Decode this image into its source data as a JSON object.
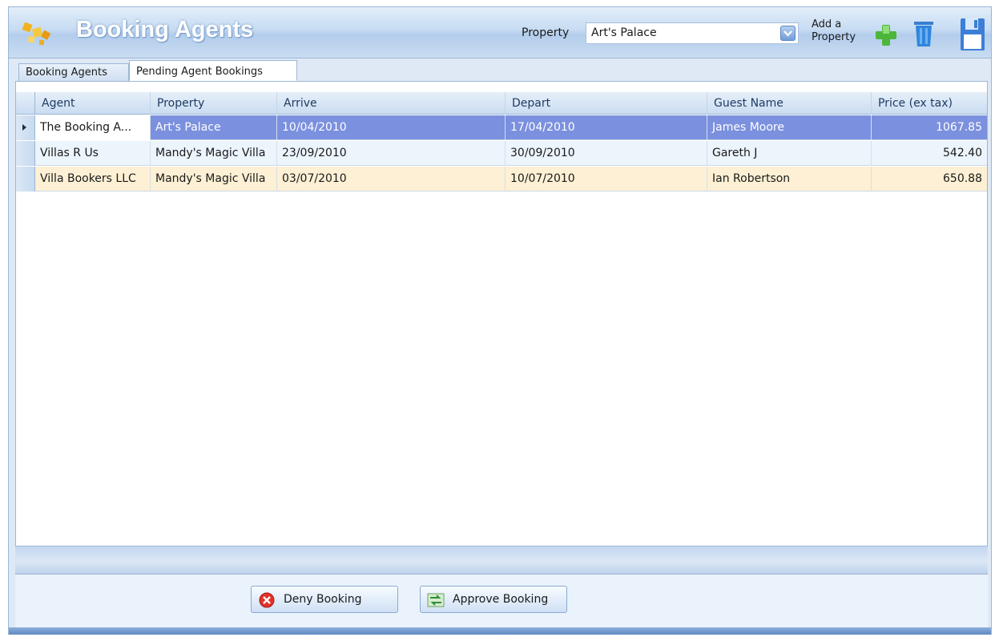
{
  "app": {
    "title": "Booking Agents"
  },
  "toolbar": {
    "property_label": "Property",
    "property_value": "Art's Palace",
    "add_property_line1": "Add a",
    "add_property_line2": "Property",
    "icons": [
      "app-logo-icon",
      "add-icon",
      "delete-icon",
      "save-icon"
    ]
  },
  "tabs": [
    {
      "label": "Booking Agents",
      "active": false
    },
    {
      "label": "Pending Agent Bookings",
      "active": true
    }
  ],
  "grid": {
    "columns": [
      "Agent",
      "Property",
      "Arrive",
      "Depart",
      "Guest Name",
      "Price (ex tax)"
    ],
    "rows": [
      {
        "agent": "The Booking A...",
        "property": "Art's Palace",
        "arrive": "10/04/2010",
        "depart": "17/04/2010",
        "guest": "James Moore",
        "price": "1067.85"
      },
      {
        "agent": "Villas R Us",
        "property": "Mandy's Magic Villa",
        "arrive": "23/09/2010",
        "depart": "30/09/2010",
        "guest": "Gareth J",
        "price": "542.40"
      },
      {
        "agent": "Villa Bookers LLC",
        "property": "Mandy's Magic Villa",
        "arrive": "03/07/2010",
        "depart": "10/07/2010",
        "guest": "Ian Robertson",
        "price": "650.88"
      }
    ]
  },
  "actions": {
    "deny_label": "Deny Booking",
    "approve_label": "Approve Booking"
  },
  "colors": {
    "selected_row": "#7b90de",
    "alt_row": "#ecf4fc",
    "highlight_row": "#fdf0d4",
    "title_text": "#ffffff"
  }
}
